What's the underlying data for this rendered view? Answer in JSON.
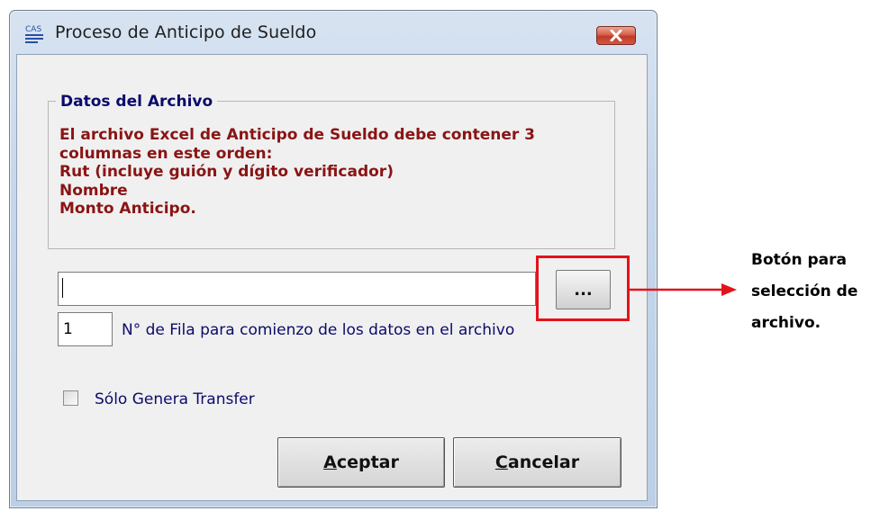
{
  "window": {
    "title": "Proceso de Anticipo de Sueldo",
    "icon": "cas-app-icon"
  },
  "group": {
    "title": "Datos del Archivo",
    "info_lines": [
      "El archivo Excel de Anticipo de Sueldo debe contener 3",
      "columnas en este orden:",
      "Rut (incluye guión y dígito verificador)",
      "Nombre",
      "Monto Anticipo."
    ]
  },
  "file_input": {
    "value": ""
  },
  "browse_button": {
    "label": "..."
  },
  "row_input": {
    "value": "1"
  },
  "row_label": "N° de Fila para comienzo de los datos en el archivo",
  "checkbox": {
    "label": "Sólo Genera Transfer",
    "checked": false
  },
  "buttons": {
    "accept": {
      "mnemonic": "A",
      "rest": "ceptar"
    },
    "cancel": {
      "mnemonic": "C",
      "rest": "ancelar"
    }
  },
  "annotation": {
    "lines": [
      "Botón para",
      "selección de",
      "archivo."
    ],
    "color": "#e3131b"
  }
}
